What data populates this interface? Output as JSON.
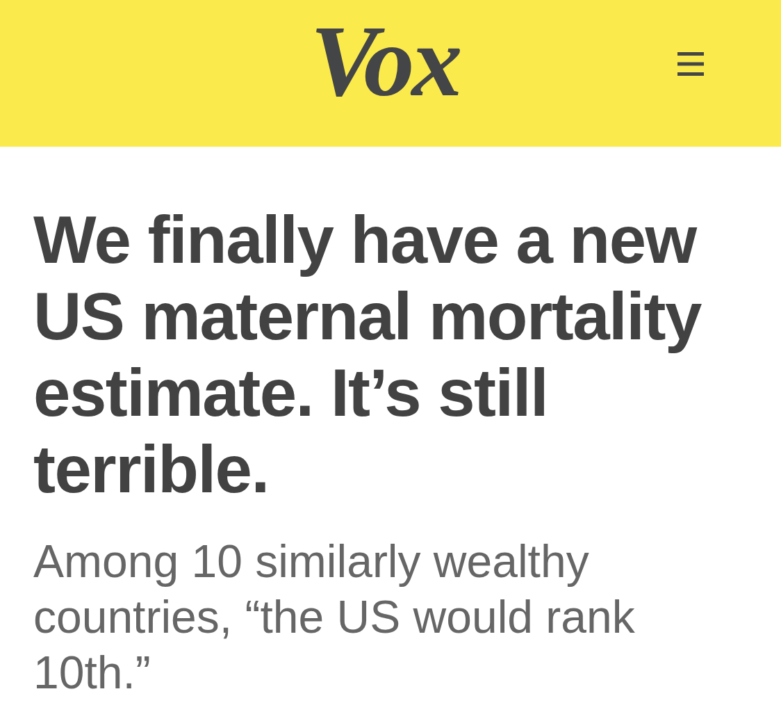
{
  "header": {
    "logo": "Vox"
  },
  "article": {
    "headline": "We finally have a new US maternal mortality estimate. It’s still terrible.",
    "dek": "Among 10 similarly wealthy countries, “the US would rank 10th.”"
  }
}
